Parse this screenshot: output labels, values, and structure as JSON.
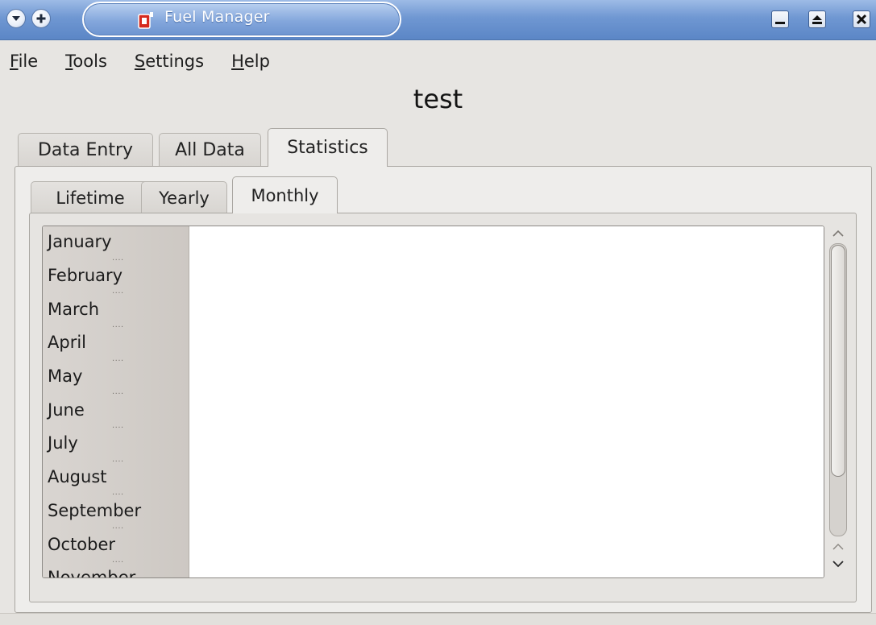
{
  "window": {
    "title": "Fuel Manager"
  },
  "menu": {
    "items": [
      {
        "mnemonic": "F",
        "rest": "ile"
      },
      {
        "mnemonic": "T",
        "rest": "ools"
      },
      {
        "mnemonic": "S",
        "rest": "ettings"
      },
      {
        "mnemonic": "H",
        "rest": "elp"
      }
    ]
  },
  "header": {
    "title": "test"
  },
  "tabs": {
    "outer": [
      "Data Entry",
      "All Data",
      "Statistics"
    ],
    "outer_active": "Statistics",
    "inner": [
      "Lifetime",
      "Yearly",
      "Monthly"
    ],
    "inner_active": "Monthly"
  },
  "months": [
    "January",
    "February",
    "March",
    "April",
    "May",
    "June",
    "July",
    "August",
    "September",
    "October",
    "November"
  ],
  "colors": {
    "titlebar": "#6f97d2",
    "window_bg": "#e7e5e2",
    "app_icon_red": "#d62a1e"
  },
  "icons": {
    "menu_button": "chevron-down-icon",
    "sticky_button": "plus-icon",
    "app": "fuel-can-icon",
    "minimize": "minimize-icon",
    "maximize": "maximize-icon",
    "close": "close-icon",
    "scroll_up": "chevron-up-icon",
    "scroll_down": "chevron-down-icon"
  }
}
